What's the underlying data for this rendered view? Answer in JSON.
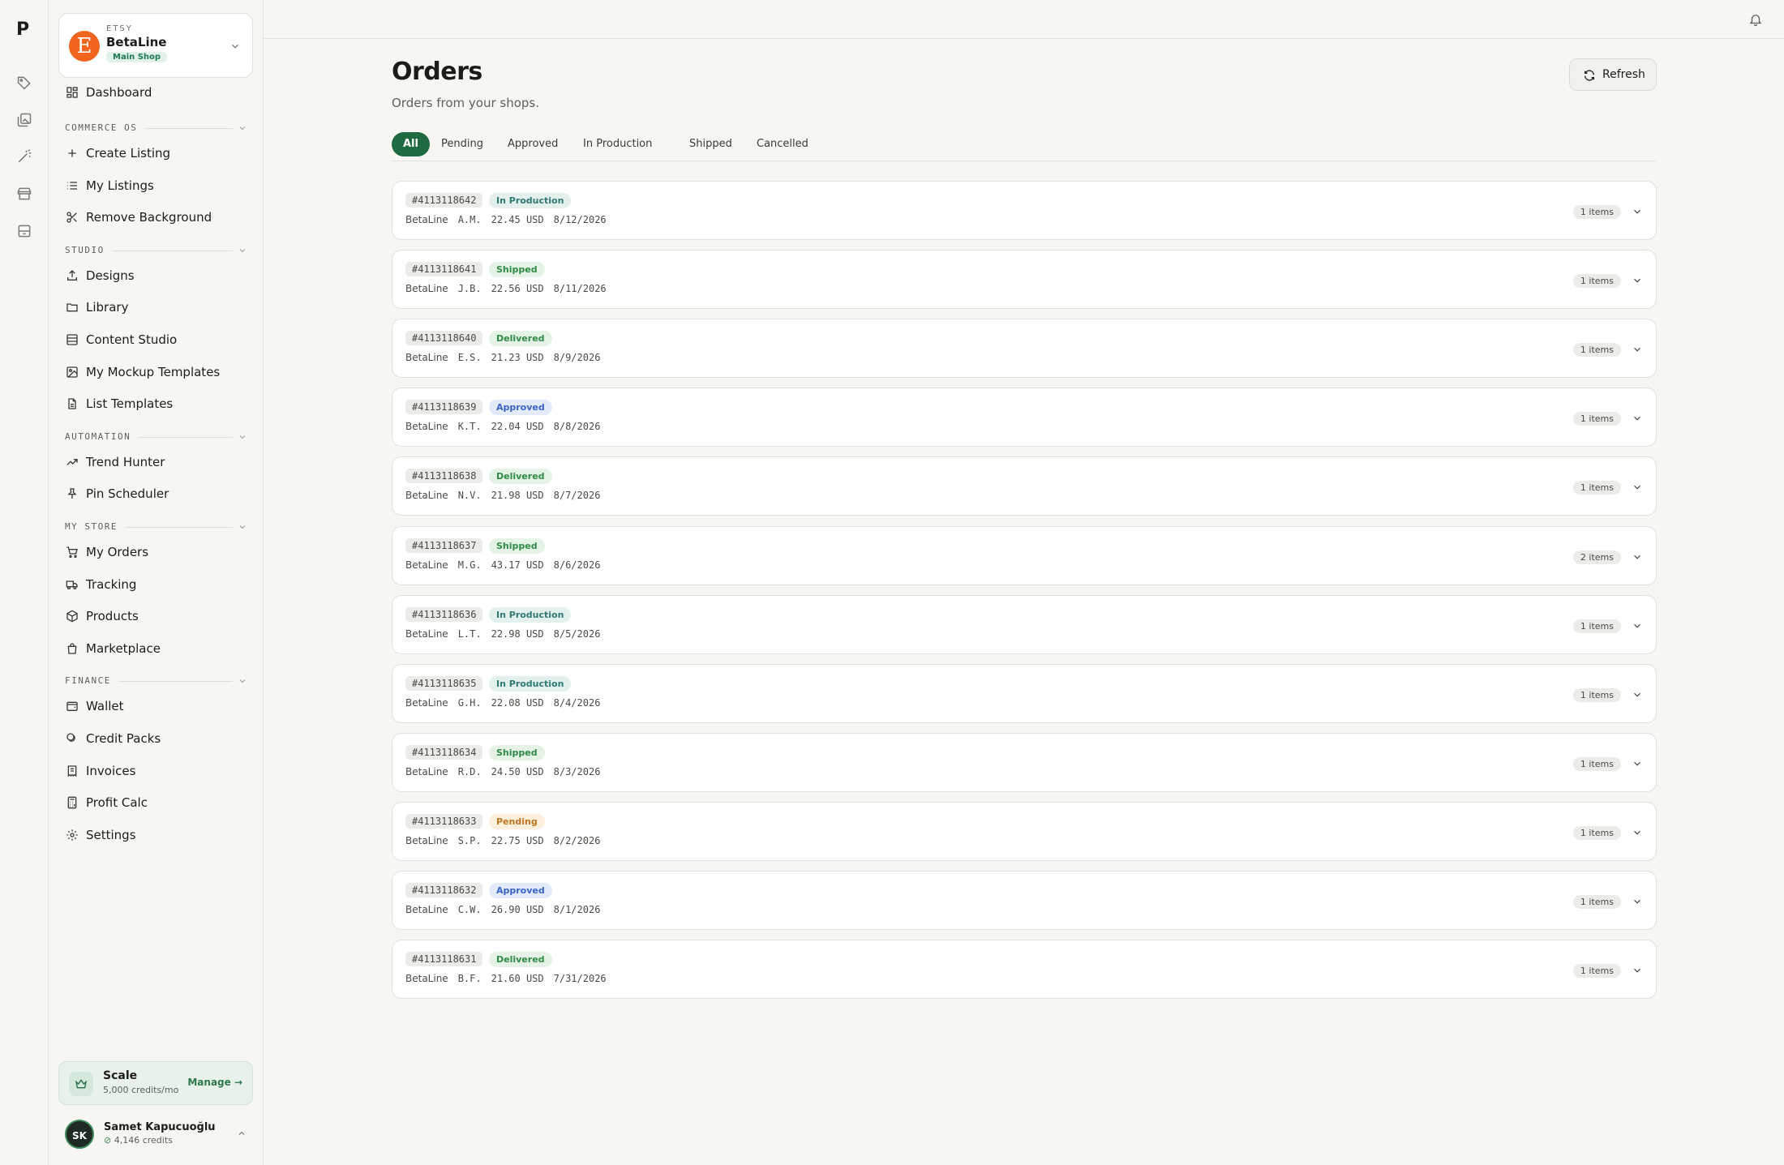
{
  "rail": {
    "logo": "P",
    "icons": [
      "tag-icon",
      "images-icon",
      "wand-icon",
      "store-icon",
      "archive-icon"
    ]
  },
  "shop": {
    "platform": "ETSY",
    "name": "BetaLine",
    "badge": "Main Shop",
    "avatar_letter": "E",
    "color": "#f1641e"
  },
  "nav": {
    "dashboard": "Dashboard",
    "commerce": {
      "title": "COMMERCE OS",
      "create": "Create Listing",
      "listings": "My Listings",
      "remove_bg": "Remove Background"
    },
    "studio": {
      "title": "STUDIO",
      "designs": "Designs",
      "library": "Library",
      "content": "Content Studio",
      "mockups": "My Mockup Templates",
      "list_templates": "List Templates"
    },
    "automation": {
      "title": "AUTOMATION",
      "trend": "Trend Hunter",
      "pin": "Pin Scheduler"
    },
    "mystore": {
      "title": "MY STORE",
      "orders": "My Orders",
      "tracking": "Tracking",
      "products": "Products",
      "marketplace": "Marketplace"
    },
    "finance": {
      "title": "FINANCE",
      "wallet": "Wallet",
      "credit_packs": "Credit Packs",
      "invoices": "Invoices",
      "profit": "Profit Calc"
    },
    "settings": "Settings"
  },
  "plan": {
    "name": "Scale",
    "credits": "5,000 credits/mo",
    "manage": "Manage →"
  },
  "user": {
    "initials": "SK",
    "name": "Samet Kapucuoğlu",
    "credits": "4,146 credits"
  },
  "page": {
    "title": "Orders",
    "subtitle": "Orders from your shops.",
    "refresh": "Refresh"
  },
  "tabs": [
    "All",
    "Pending",
    "Approved",
    "In Production",
    "Shipped",
    "Cancelled"
  ],
  "status_colors": {
    "In Production": {
      "bg": "#e3f0ee",
      "fg": "#2f7a73"
    },
    "Shipped": {
      "bg": "#e4f3e6",
      "fg": "#2f8a45"
    },
    "Delivered": {
      "bg": "#e4f3e6",
      "fg": "#2f8a45"
    },
    "Approved": {
      "bg": "#e3ebfb",
      "fg": "#3b62c6"
    },
    "Pending": {
      "bg": "#fcefdc",
      "fg": "#c07522"
    }
  },
  "orders": [
    {
      "id": "#4113118642",
      "status": "In Production",
      "shop": "BetaLine",
      "customer": "A.M.",
      "price": "22.45 USD",
      "date": "8/12/2026",
      "items": "1 items"
    },
    {
      "id": "#4113118641",
      "status": "Shipped",
      "shop": "BetaLine",
      "customer": "J.B.",
      "price": "22.56 USD",
      "date": "8/11/2026",
      "items": "1 items"
    },
    {
      "id": "#4113118640",
      "status": "Delivered",
      "shop": "BetaLine",
      "customer": "E.S.",
      "price": "21.23 USD",
      "date": "8/9/2026",
      "items": "1 items"
    },
    {
      "id": "#4113118639",
      "status": "Approved",
      "shop": "BetaLine",
      "customer": "K.T.",
      "price": "22.04 USD",
      "date": "8/8/2026",
      "items": "1 items"
    },
    {
      "id": "#4113118638",
      "status": "Delivered",
      "shop": "BetaLine",
      "customer": "N.V.",
      "price": "21.98 USD",
      "date": "8/7/2026",
      "items": "1 items"
    },
    {
      "id": "#4113118637",
      "status": "Shipped",
      "shop": "BetaLine",
      "customer": "M.G.",
      "price": "43.17 USD",
      "date": "8/6/2026",
      "items": "2 items"
    },
    {
      "id": "#4113118636",
      "status": "In Production",
      "shop": "BetaLine",
      "customer": "L.T.",
      "price": "22.98 USD",
      "date": "8/5/2026",
      "items": "1 items"
    },
    {
      "id": "#4113118635",
      "status": "In Production",
      "shop": "BetaLine",
      "customer": "G.H.",
      "price": "22.08 USD",
      "date": "8/4/2026",
      "items": "1 items"
    },
    {
      "id": "#4113118634",
      "status": "Shipped",
      "shop": "BetaLine",
      "customer": "R.D.",
      "price": "24.50 USD",
      "date": "8/3/2026",
      "items": "1 items"
    },
    {
      "id": "#4113118633",
      "status": "Pending",
      "shop": "BetaLine",
      "customer": "S.P.",
      "price": "22.75 USD",
      "date": "8/2/2026",
      "items": "1 items"
    },
    {
      "id": "#4113118632",
      "status": "Approved",
      "shop": "BetaLine",
      "customer": "C.W.",
      "price": "26.90 USD",
      "date": "8/1/2026",
      "items": "1 items"
    },
    {
      "id": "#4113118631",
      "status": "Delivered",
      "shop": "BetaLine",
      "customer": "B.F.",
      "price": "21.60 USD",
      "date": "7/31/2026",
      "items": "1 items"
    }
  ]
}
